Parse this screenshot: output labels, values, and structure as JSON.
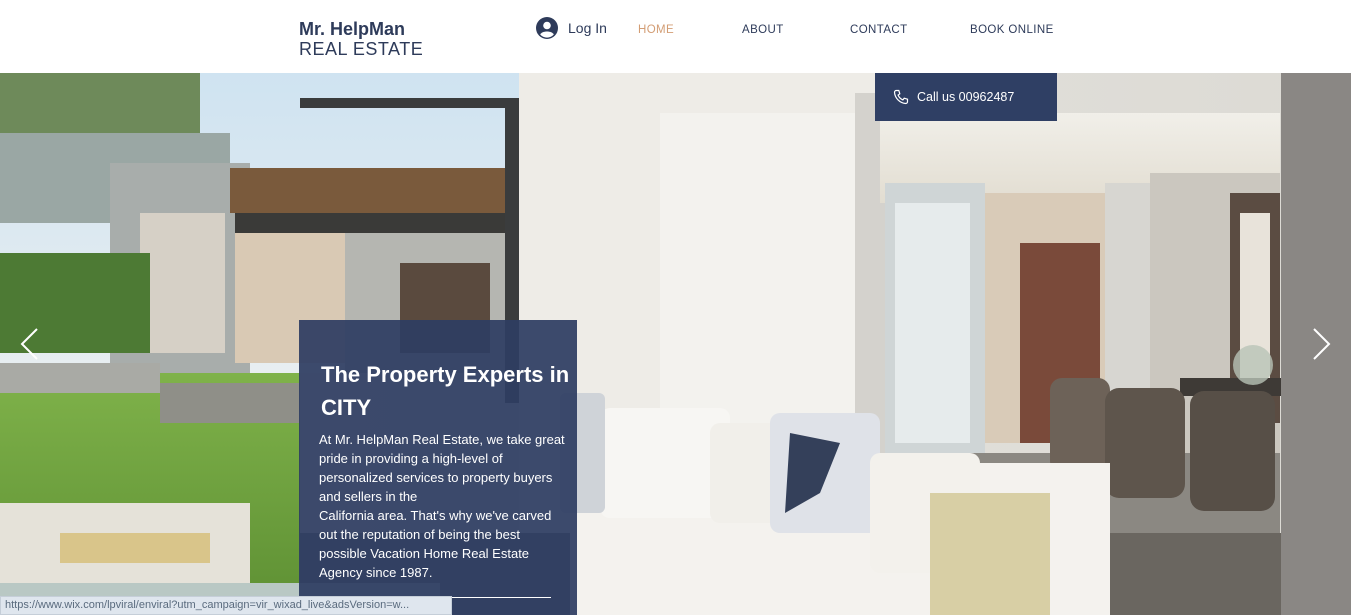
{
  "header": {
    "logo_main": "Mr. HelpMan",
    "logo_sub": "REAL ESTATE",
    "login_label": "Log In",
    "nav": [
      {
        "label": "HOME",
        "active": true
      },
      {
        "label": "ABOUT",
        "active": false
      },
      {
        "label": "CONTACT",
        "active": false
      },
      {
        "label": "BOOK ONLINE",
        "active": false
      }
    ]
  },
  "call": {
    "label": "Call us 00962487"
  },
  "hero": {
    "title": "The Property Experts in CITY",
    "description": "At Mr. HelpMan Real Estate, we take great pride in providing a high-level of personalized services to property buyers and sellers in the\nCalifornia area. That's why we've carved out the reputation of being the best possible Vacation Home Real Estate Agency since 1987."
  },
  "status_bar": {
    "url": "https://www.wix.com/lpviral/enviral?utm_campaign=vir_wixad_live&adsVersion=w..."
  },
  "colors": {
    "brand": "#2e3b5a",
    "accent": "#d39d74",
    "box": "#2f3f64"
  },
  "icons": [
    "user-avatar-icon",
    "phone-icon",
    "chevron-left-icon",
    "chevron-right-icon"
  ]
}
